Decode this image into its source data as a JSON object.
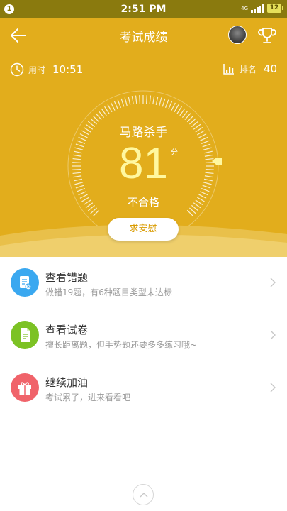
{
  "status_bar": {
    "notification_count": "1",
    "time": "2:51 PM",
    "network": "4G",
    "battery": "12"
  },
  "header": {
    "title": "考试成绩",
    "back_icon": "arrow-left-icon",
    "trophy_icon": "trophy-icon"
  },
  "stats": {
    "time_label": "用时",
    "time_value": "10:51",
    "rank_label": "排名",
    "rank_value": "40"
  },
  "result": {
    "nickname": "马路杀手",
    "score": "81",
    "unit": "分",
    "verdict": "不合格",
    "comfort_button": "求安慰"
  },
  "menu": [
    {
      "title": "查看错题",
      "subtitle": "做错19题，有6种题目类型未达标",
      "icon": "wrong-questions-icon",
      "color": "#3aa8f0"
    },
    {
      "title": "查看试卷",
      "subtitle": "擅长距离题，但手势题还要多多练习哦~",
      "icon": "document-icon",
      "color": "#7cc224"
    },
    {
      "title": "继续加油",
      "subtitle": "考试累了，进来看看吧",
      "icon": "gift-icon",
      "color": "#f0636a"
    }
  ],
  "colors": {
    "hero_bg": "#e2ad1c",
    "status_bg": "#8a7a0e",
    "score_color": "#fff8a0"
  }
}
